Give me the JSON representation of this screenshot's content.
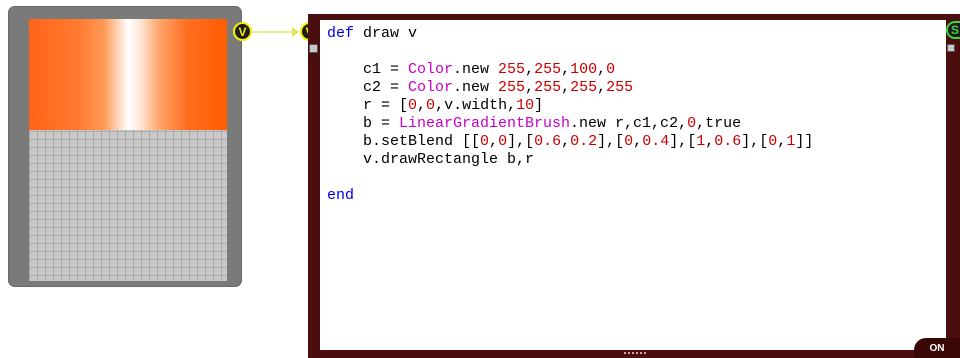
{
  "preview": {
    "gradient_colors": [
      "#ff6418",
      "#ffffff",
      "#ff5c00"
    ],
    "screen_color": "#c9c9c9"
  },
  "connector": {
    "out_pin_label": "V",
    "in_pin_label": "V",
    "wire_color": "#e9ec8c"
  },
  "editor": {
    "frame_color": "#4b0e0e",
    "side_pin_label": "S",
    "status_badge": "ON",
    "code_lines": [
      [
        {
          "t": "def",
          "c": "kw"
        },
        {
          "t": " draw v"
        }
      ],
      [],
      [
        {
          "t": "    c1 = "
        },
        {
          "t": "Color",
          "c": "cls"
        },
        {
          "t": ".new "
        },
        {
          "t": "255",
          "c": "num"
        },
        {
          "t": ","
        },
        {
          "t": "255",
          "c": "num"
        },
        {
          "t": ","
        },
        {
          "t": "100",
          "c": "num"
        },
        {
          "t": ","
        },
        {
          "t": "0",
          "c": "num"
        }
      ],
      [
        {
          "t": "    c2 = "
        },
        {
          "t": "Color",
          "c": "cls"
        },
        {
          "t": ".new "
        },
        {
          "t": "255",
          "c": "num"
        },
        {
          "t": ","
        },
        {
          "t": "255",
          "c": "num"
        },
        {
          "t": ","
        },
        {
          "t": "255",
          "c": "num"
        },
        {
          "t": ","
        },
        {
          "t": "255",
          "c": "num"
        }
      ],
      [
        {
          "t": "    r = ["
        },
        {
          "t": "0",
          "c": "num"
        },
        {
          "t": ","
        },
        {
          "t": "0",
          "c": "num"
        },
        {
          "t": ",v.width,"
        },
        {
          "t": "10",
          "c": "num"
        },
        {
          "t": "]"
        }
      ],
      [
        {
          "t": "    b = "
        },
        {
          "t": "LinearGradientBrush",
          "c": "cls"
        },
        {
          "t": ".new r,c1,c2,"
        },
        {
          "t": "0",
          "c": "num"
        },
        {
          "t": ",true"
        }
      ],
      [
        {
          "t": "    b.setBlend [["
        },
        {
          "t": "0",
          "c": "num"
        },
        {
          "t": ","
        },
        {
          "t": "0",
          "c": "num"
        },
        {
          "t": "],["
        },
        {
          "t": "0.6",
          "c": "num"
        },
        {
          "t": ","
        },
        {
          "t": "0.2",
          "c": "num"
        },
        {
          "t": "],["
        },
        {
          "t": "0",
          "c": "num"
        },
        {
          "t": ","
        },
        {
          "t": "0.4",
          "c": "num"
        },
        {
          "t": "],["
        },
        {
          "t": "1",
          "c": "num"
        },
        {
          "t": ","
        },
        {
          "t": "0.6",
          "c": "num"
        },
        {
          "t": "],["
        },
        {
          "t": "0",
          "c": "num"
        },
        {
          "t": ","
        },
        {
          "t": "1",
          "c": "num"
        },
        {
          "t": "]]"
        }
      ],
      [
        {
          "t": "    v.drawRectangle b,r"
        }
      ],
      [],
      [
        {
          "t": "end",
          "c": "kw"
        }
      ]
    ]
  }
}
